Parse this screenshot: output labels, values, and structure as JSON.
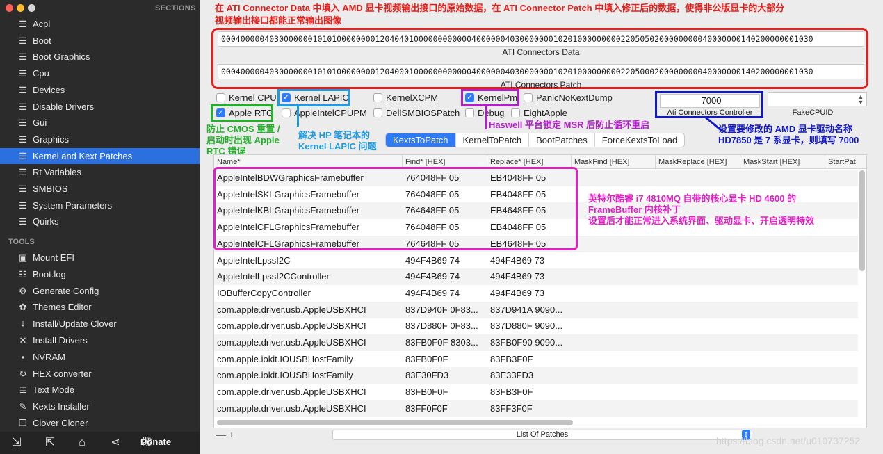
{
  "sidebar": {
    "sections_title": "SECTIONS",
    "items": [
      {
        "label": "Acpi",
        "icon": "list-icon"
      },
      {
        "label": "Boot",
        "icon": "list-icon"
      },
      {
        "label": "Boot Graphics",
        "icon": "list-icon"
      },
      {
        "label": "Cpu",
        "icon": "list-icon"
      },
      {
        "label": "Devices",
        "icon": "list-icon"
      },
      {
        "label": "Disable Drivers",
        "icon": "list-icon"
      },
      {
        "label": "Gui",
        "icon": "list-icon"
      },
      {
        "label": "Graphics",
        "icon": "list-icon"
      },
      {
        "label": "Kernel and Kext Patches",
        "icon": "list-icon",
        "active": true
      },
      {
        "label": "Rt Variables",
        "icon": "list-icon"
      },
      {
        "label": "SMBIOS",
        "icon": "list-icon"
      },
      {
        "label": "System Parameters",
        "icon": "list-icon"
      },
      {
        "label": "Quirks",
        "icon": "list-icon"
      }
    ],
    "tools_title": "TOOLS",
    "tools": [
      {
        "label": "Mount EFI",
        "icon": "disk-icon"
      },
      {
        "label": "Boot.log",
        "icon": "log-icon"
      },
      {
        "label": "Generate Config",
        "icon": "gears-icon"
      },
      {
        "label": "Themes Editor",
        "icon": "palette-icon"
      },
      {
        "label": "Install/Update Clover",
        "icon": "download-icon"
      },
      {
        "label": "Install Drivers",
        "icon": "wrench-icon"
      },
      {
        "label": "NVRAM",
        "icon": "chip-icon"
      },
      {
        "label": "HEX converter",
        "icon": "convert-icon"
      },
      {
        "label": "Text Mode",
        "icon": "text-icon"
      },
      {
        "label": "Kexts Installer",
        "icon": "installer-icon"
      },
      {
        "label": "Clover Cloner",
        "icon": "clone-icon"
      }
    ],
    "bottom": {
      "donate_label": "Donate",
      "paypal_top": "Pay",
      "paypal_bottom": "Pal"
    }
  },
  "annotations": {
    "top_red": "在 ATI Connector Data 中填入 AMD 显卡视频输出接口的原始数据，在 ATI Connector Patch 中填入修正后的数据，使得非公版显卡的大部分",
    "top_red_2": "视频输出接口都能正常输出图像",
    "green": [
      "防止 CMOS 重置 /",
      "启动时出现 Apple",
      "RTC 错误"
    ],
    "blue_light": [
      "解决 HP 笔记本的",
      "Kernel LAPIC 问题"
    ],
    "purple": "Haswell 平台锁定 MSR 后防止循环重启",
    "darkblue": [
      "设置要修改的 AMD 显卡驱动名称",
      "HD7850 是 7 系显卡，则填写 7000"
    ],
    "magenta": [
      "英特尔酷睿 i7 4810MQ 自带的核心显卡 HD 4600 的",
      "FrameBuffer 内核补丁",
      "设置后才能正常进入系统界面、驱动显卡、开启透明特效"
    ]
  },
  "ati": {
    "data_value": "000400000403000000010101000000001204040100000000000040000004030000000102010000000002205050200000000040000000140200000001030",
    "data_label": "ATI Connectors Data",
    "patch_value": "000400000403000000010101000000001204000100000000000040000004030000000102010000000002205000200000000040000000140200000001030",
    "patch_label": "ATI Connectors Patch"
  },
  "checks": [
    {
      "label": "Kernel CPU",
      "checked": false
    },
    {
      "label": "Kernel LAPIC",
      "checked": true
    },
    {
      "label": "KernelXCPM",
      "checked": false
    },
    {
      "label": "KernelPm",
      "checked": true
    },
    {
      "label": "PanicNoKextDump",
      "checked": false
    },
    {
      "label": "Apple RTC",
      "checked": true
    },
    {
      "label": "AppleIntelCPUPM",
      "checked": false
    },
    {
      "label": "DellSMBIOSPatch",
      "checked": false
    },
    {
      "label": "Debug",
      "checked": false
    },
    {
      "label": "EightApple",
      "checked": false
    }
  ],
  "controller": {
    "value": "7000",
    "label": "Ati Connectors Controller"
  },
  "fakecpuid": {
    "value": "",
    "label": "FakeCPUID"
  },
  "tabs": [
    "KextsToPatch",
    "KernelToPatch",
    "BootPatches",
    "ForceKextsToLoad"
  ],
  "table": {
    "columns": [
      "Name*",
      "Find* [HEX]",
      "Replace* [HEX]",
      "MaskFind [HEX]",
      "MaskReplace [HEX]",
      "MaskStart [HEX]",
      "StartPat"
    ],
    "rows": [
      [
        "AppleIntelBDWGraphicsFramebuffer",
        "764048FF 05",
        "EB4048FF 05"
      ],
      [
        "AppleIntelSKLGraphicsFramebuffer",
        "764048FF 05",
        "EB4048FF 05"
      ],
      [
        "AppleIntelKBLGraphicsFramebuffer",
        "764648FF 05",
        "EB4648FF 05"
      ],
      [
        "AppleIntelCFLGraphicsFramebuffer",
        "764048FF 05",
        "EB4048FF 05"
      ],
      [
        "AppleIntelCFLGraphicsFramebuffer",
        "764648FF 05",
        "EB4648FF 05"
      ],
      [
        "AppleIntelLpssI2C",
        "494F4B69 74",
        "494F4B69 73"
      ],
      [
        "AppleIntelLpssI2CController",
        "494F4B69 74",
        "494F4B69 73"
      ],
      [
        "IOBufferCopyController",
        "494F4B69 74",
        "494F4B69 73"
      ],
      [
        "com.apple.driver.usb.AppleUSBXHCI",
        "837D940F 0F83...",
        "837D941A 9090..."
      ],
      [
        "com.apple.driver.usb.AppleUSBXHCI",
        "837D880F 0F83...",
        "837D880F 9090..."
      ],
      [
        "com.apple.driver.usb.AppleUSBXHCI",
        "83FB0F0F 8303...",
        "83FB0F90 9090..."
      ],
      [
        "com.apple.iokit.IOUSBHostFamily",
        "83FB0F0F",
        "83FB3F0F"
      ],
      [
        "com.apple.iokit.IOUSBHostFamily",
        "83E30FD3",
        "83E33FD3"
      ],
      [
        "com.apple.driver.usb.AppleUSBXHCI",
        "83FB0F0F",
        "83FB3F0F"
      ],
      [
        "com.apple.driver.usb.AppleUSBXHCI",
        "83FF0F0F",
        "83FF3F0F"
      ]
    ]
  },
  "bottom": {
    "add_remove": "— +",
    "list_label": "List Of Patches"
  },
  "watermark": "https://blog.csdn.net/u010737252",
  "colors": {
    "red": "#e3201b",
    "green": "#22b02a",
    "light_blue": "#1f9be0",
    "purple": "#b01fc8",
    "dark_blue": "#1018c8",
    "magenta": "#e21ec5",
    "accent": "#2f7bf5"
  }
}
